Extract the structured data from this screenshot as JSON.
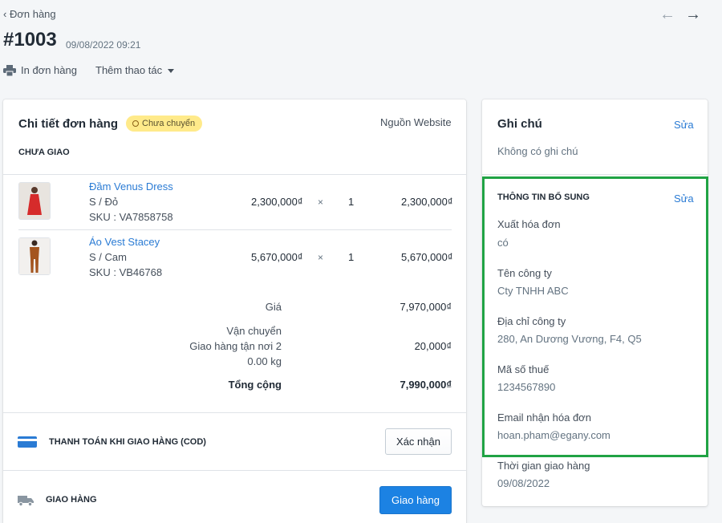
{
  "header": {
    "back_label": "Đơn hàng",
    "order_id": "#1003",
    "order_date": "09/08/2022 09:21",
    "actions": {
      "print": "In đơn hàng",
      "more": "Thêm thao tác"
    }
  },
  "order": {
    "title": "Chi tiết đơn hàng",
    "status": "Chưa chuyển",
    "source": "Nguồn Website",
    "fulfillment_status": "CHƯA GIAO",
    "items": [
      {
        "name": "Đầm Venus Dress",
        "variant": "S / Đỏ",
        "sku": "SKU : VA7858758",
        "price": "2,300,000₫",
        "times": "×",
        "qty": "1",
        "total": "2,300,000₫"
      },
      {
        "name": "Áo Vest Stacey",
        "variant": "S / Cam",
        "sku": "SKU : VB46768",
        "price": "5,670,000₫",
        "times": "×",
        "qty": "1",
        "total": "5,670,000₫"
      }
    ],
    "summary": {
      "subtotal_label": "Giá",
      "subtotal": "7,970,000₫",
      "shipping_label": "Vận chuyển",
      "shipping_method": "Giao hàng tận nơi 2",
      "weight": "0.00 kg",
      "shipping": "20,000₫",
      "total_label": "Tổng cộng",
      "total": "7,990,000₫"
    },
    "payment": {
      "label": "THANH TOÁN KHI GIAO HÀNG (COD)",
      "button": "Xác nhận"
    },
    "delivery": {
      "label": "GIAO HÀNG",
      "button": "Giao hàng"
    }
  },
  "sidebar": {
    "note_title": "Ghi chú",
    "note_edit": "Sửa",
    "note_body": "Không có ghi chú",
    "extra_title": "THÔNG TIN BỔ SUNG",
    "extra_edit": "Sửa",
    "fields": [
      {
        "label": "Xuất hóa đơn",
        "value": "có"
      },
      {
        "label": "Tên công ty",
        "value": "Cty TNHH ABC"
      },
      {
        "label": "Địa chỉ công ty",
        "value": "280, An Dương Vương, F4, Q5"
      },
      {
        "label": "Mã số thuế",
        "value": "1234567890"
      },
      {
        "label": "Email nhận hóa đơn",
        "value": "hoan.pham@egany.com"
      },
      {
        "label": "Thời gian giao hàng",
        "value": "09/08/2022"
      }
    ]
  },
  "colors": {
    "highlight": "#20a344",
    "primary": "#1c82e3",
    "link": "#2a7bd4",
    "badge": "#ffea8a"
  }
}
